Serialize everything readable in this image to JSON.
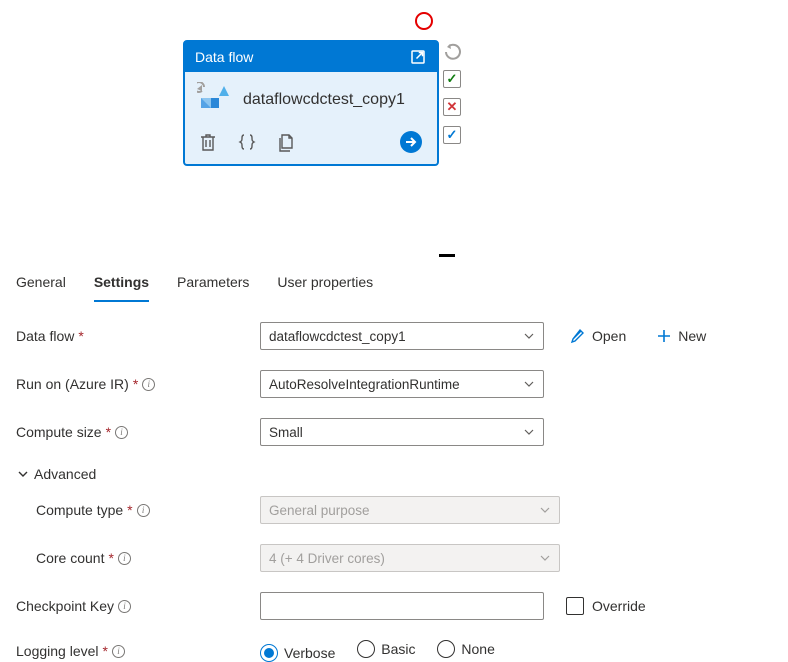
{
  "card": {
    "header": "Data flow",
    "name": "dataflowcdctest_copy1"
  },
  "status": {
    "ok": "✓",
    "fail": "✕",
    "flag": "✓"
  },
  "tabs": [
    "General",
    "Settings",
    "Parameters",
    "User properties"
  ],
  "active_tab": 1,
  "form": {
    "dataflow_label": "Data flow",
    "dataflow_value": "dataflowcdctest_copy1",
    "open_label": "Open",
    "new_label": "New",
    "runon_label": "Run on (Azure IR)",
    "runon_value": "AutoResolveIntegrationRuntime",
    "compute_size_label": "Compute size",
    "compute_size_value": "Small",
    "advanced_label": "Advanced",
    "compute_type_label": "Compute type",
    "compute_type_value": "General purpose",
    "core_count_label": "Core count",
    "core_count_value": "4 (+ 4 Driver cores)",
    "checkpoint_label": "Checkpoint Key",
    "checkpoint_value": "",
    "override_label": "Override",
    "logging_label": "Logging level",
    "logging_options": [
      "Verbose",
      "Basic",
      "None"
    ],
    "logging_selected": 0
  }
}
